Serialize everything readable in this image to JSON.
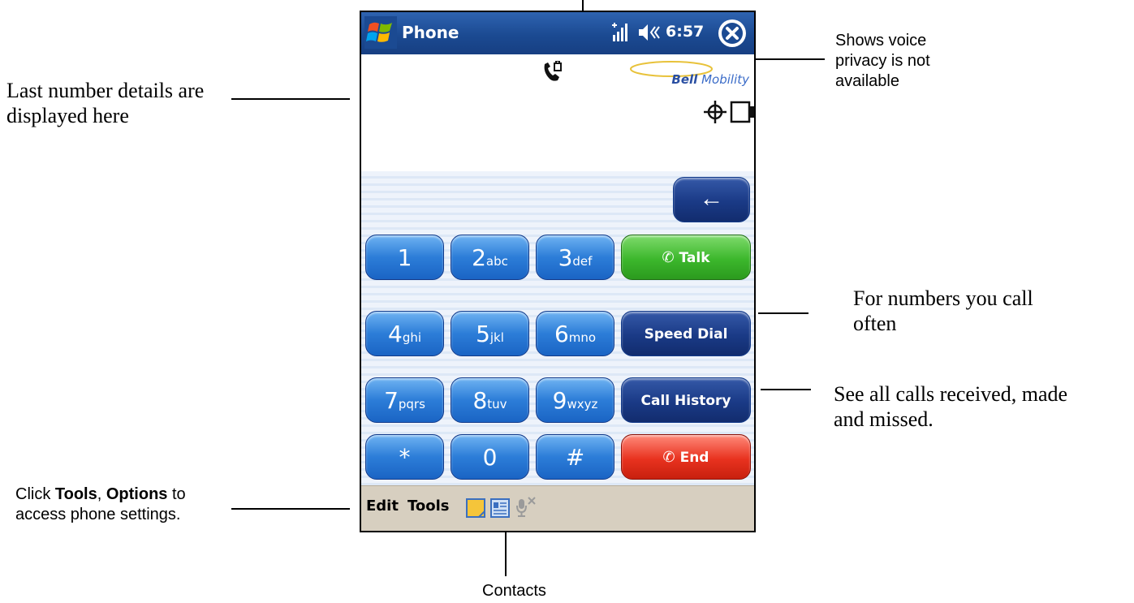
{
  "titlebar": {
    "app_title": "Phone",
    "time": "6:57"
  },
  "display": {
    "brand_bold": "Bell",
    "brand_rest": "Mobility"
  },
  "keypad": {
    "backspace_label": "←",
    "keys": [
      {
        "num": "1",
        "letters": ""
      },
      {
        "num": "2",
        "letters": "abc"
      },
      {
        "num": "3",
        "letters": "def"
      },
      {
        "num": "4",
        "letters": "ghi"
      },
      {
        "num": "5",
        "letters": "jkl"
      },
      {
        "num": "6",
        "letters": "mno"
      },
      {
        "num": "7",
        "letters": "pqrs"
      },
      {
        "num": "8",
        "letters": "tuv"
      },
      {
        "num": "9",
        "letters": "wxyz"
      },
      {
        "num": "*",
        "letters": ""
      },
      {
        "num": "0",
        "letters": ""
      },
      {
        "num": "#",
        "letters": ""
      }
    ],
    "talk_label": "Talk",
    "speed_dial_label": "Speed Dial",
    "call_history_label": "Call History",
    "end_label": "End"
  },
  "menubar": {
    "edit_label": "Edit",
    "tools_label": "Tools"
  },
  "annotations": {
    "last_number_1": "Last number details are",
    "last_number_2": "displayed here",
    "privacy_1": "Shows voice",
    "privacy_2": "privacy is not",
    "privacy_3": "available",
    "speed_dial_1": "For numbers you call",
    "speed_dial_2": "often",
    "history_1": "See all calls received, made",
    "history_2": "and missed.",
    "tools_pre": "Click ",
    "tools_bold1": "Tools",
    "tools_mid": ", ",
    "tools_bold2": "Options",
    "tools_post": " to",
    "tools_2": "access phone settings.",
    "contacts": "Contacts"
  },
  "colors": {
    "title_blue": "#1b4a92",
    "talk_green": "#3cb72c",
    "end_red": "#e8321f",
    "menu_beige": "#d7cfc0"
  }
}
